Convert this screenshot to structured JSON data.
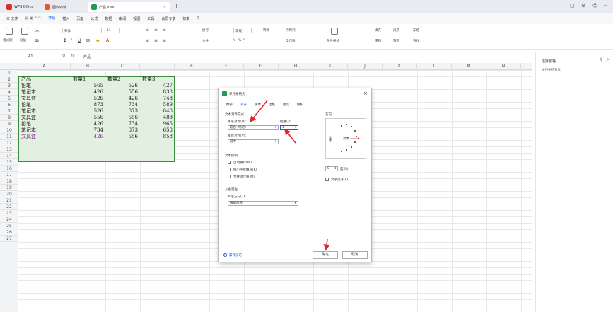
{
  "titlebar": {
    "tabs": [
      {
        "label": "WPS Office",
        "color": "#d9302c"
      },
      {
        "label": "回收商城",
        "color": "#e8572b"
      },
      {
        "label": "产品.xlsx",
        "color": "#1f9d55"
      }
    ],
    "new_tab": "+"
  },
  "menubar": {
    "items": [
      "三 文件",
      "开始",
      "插入",
      "页面",
      "公式",
      "数据",
      "审阅",
      "视图",
      "工具",
      "会员专享",
      "效率"
    ],
    "active_index": 1
  },
  "ribbon": {
    "paste": "格式刷",
    "paste2": "粘贴",
    "font_name": "宋体",
    "font_size": "11",
    "wrap": "换行",
    "merge": "合并",
    "format_general": "常规",
    "convert": "转换",
    "row_col": "行和列",
    "worksheet": "工作表",
    "cond_format": "条件格式",
    "fill": "填充",
    "sort": "排序",
    "freeze": "冻结",
    "sum": "求和",
    "filter": "筛选",
    "find": "查找"
  },
  "formulabar": {
    "cell_ref": "A1",
    "fx": "fx",
    "content": "产品"
  },
  "columns": [
    "A",
    "B",
    "C",
    "D",
    "E",
    "F",
    "G",
    "H",
    "I",
    "J",
    "K",
    "L",
    "M",
    "N"
  ],
  "rows": [
    "1",
    "2",
    "3",
    "4",
    "5",
    "6",
    "7",
    "8",
    "9",
    "10",
    "11",
    "12",
    "13",
    "14",
    "15",
    "16",
    "17",
    "18",
    "19",
    "20",
    "21",
    "22",
    "23",
    "24",
    "25",
    "26",
    "27"
  ],
  "sheet": {
    "header": [
      "产品",
      "数量1",
      "数量2",
      "数量3"
    ],
    "data": [
      [
        "铅笔",
        "565",
        "526",
        "427"
      ],
      [
        "笔记本",
        "426",
        "556",
        "838"
      ],
      [
        "文具盒",
        "526",
        "426",
        "748"
      ],
      [
        "铅笔",
        "873",
        "734",
        "589"
      ],
      [
        "笔记本",
        "526",
        "873",
        "848"
      ],
      [
        "文具盒",
        "556",
        "556",
        "488"
      ],
      [
        "铅笔",
        "426",
        "734",
        "965"
      ],
      [
        "笔记本",
        "734",
        "873",
        "658"
      ],
      [
        "文具盒",
        "426",
        "556",
        "858"
      ]
    ]
  },
  "sidepanel": {
    "title": "选择窗格",
    "subtitle": "文档中的对象"
  },
  "dialog": {
    "title": "单元格格式",
    "tabs": [
      "数字",
      "对齐",
      "字体",
      "边框",
      "图案",
      "保护"
    ],
    "active_tab": 1,
    "text_align_section": "文本对齐方式",
    "horizontal_label": "水平对齐(H):",
    "horizontal_value": "靠右 (缩进)",
    "indent_label": "缩进(I):",
    "indent_value": "1",
    "vertical_label": "垂直对齐(V):",
    "vertical_value": "居中",
    "text_control_section": "文本控制",
    "wrap_text": "自动换行(W)",
    "shrink_to_fit": "缩小字体填充(K)",
    "merge_cells": "合并单元格(M)",
    "rtl_section": "从右到左",
    "text_direction_label": "文字方向(T):",
    "text_direction_value": "根据内容",
    "orientation_label": "方向",
    "orientation_vertical_text": "文本",
    "orientation_text": "文本",
    "degree_value": "0",
    "degree_label": "度(D)",
    "stacked_text": "文字竖排(L)",
    "help_link": "操作技巧",
    "ok_label": "确定",
    "cancel_label": "取消"
  },
  "colors": {
    "selection_fill": "#e3efe0",
    "selection_border": "#3c8c3c",
    "arrow": "#e0242a",
    "accent": "#1a56db"
  }
}
